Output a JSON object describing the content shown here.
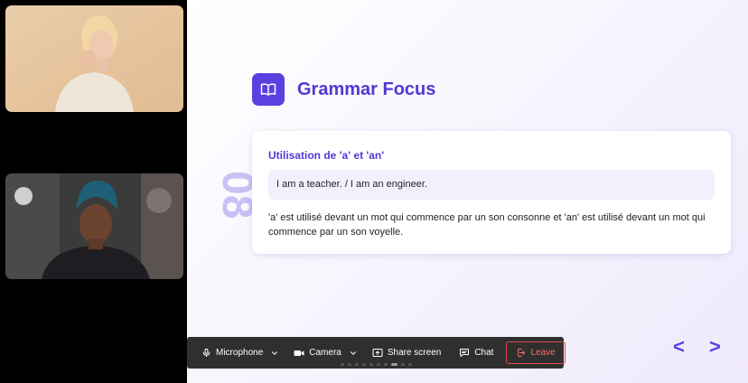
{
  "participants": [
    {
      "label": "participant-video-1"
    },
    {
      "label": "participant-video-2"
    }
  ],
  "slide": {
    "number": "08",
    "title": "Grammar Focus",
    "title_icon": "book-icon",
    "card": {
      "heading": "Utilisation de 'a' et 'an'",
      "example": "I am a teacher. / I am an engineer.",
      "explanation": "'a' est utilisé devant un mot qui commence par un son consonne et 'an' est utilisé devant un mot qui commence par un son voyelle."
    },
    "nav": {
      "prev": "<",
      "next": ">"
    }
  },
  "controls": {
    "microphone": "Microphone",
    "camera": "Camera",
    "share_screen": "Share screen",
    "chat": "Chat",
    "leave": "Leave"
  },
  "colors": {
    "accent": "#5b3fe0",
    "leave": "#e5484d",
    "bar": "#2f2f2f"
  }
}
